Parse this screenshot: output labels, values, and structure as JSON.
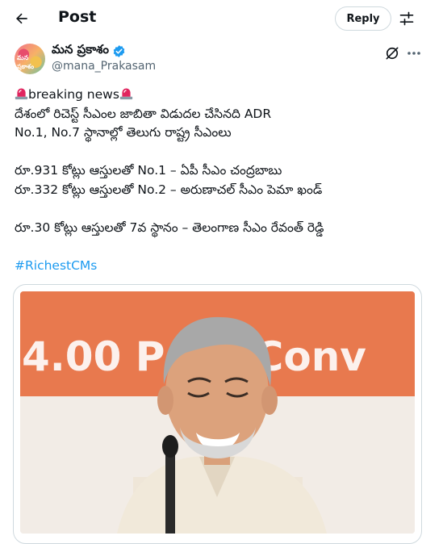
{
  "header": {
    "title": "Post",
    "reply_label": "Reply"
  },
  "author": {
    "name": "మన ప్రకాశం",
    "handle": "@mana_Prakasam",
    "avatar_text": "మన ప్రకాశం"
  },
  "tweet": {
    "line1": "breaking news",
    "line2": "దేశంలో రిచెస్ట్ సీఎంల జాబితా విడుదల చేసినది ADR",
    "line3": "No.1, No.7 స్థానాల్లో తెలుగు రాష్ట్ర సీఎంలు",
    "line4": "రూ.931 కోట్లు ఆస్తులతో No.1 –  ఏపీ సీఎం చంద్రబాబు",
    "line5": "రూ.332 కోట్లు ఆస్తులతో No.2 – అరుణాచల్ సీఎం పెమా ఖండ్",
    "line6": "రూ.30 కోట్లు ఆస్తులతో 7వ స్థానం – తెలంగాణ సీఎం రేవంత్ రెడ్డి",
    "hashtag": "#RichestCMs"
  },
  "media": {
    "banner_text": "4.00 P  CK Conv"
  },
  "colors": {
    "accent": "#1d9bf0",
    "verified": "#1d9bf0",
    "siren": "#e0245e",
    "banner": "#e8794e"
  },
  "icons": [
    "back-arrow-icon",
    "settings-icon",
    "verified-icon",
    "grok-icon",
    "more-icon",
    "siren-icon"
  ]
}
